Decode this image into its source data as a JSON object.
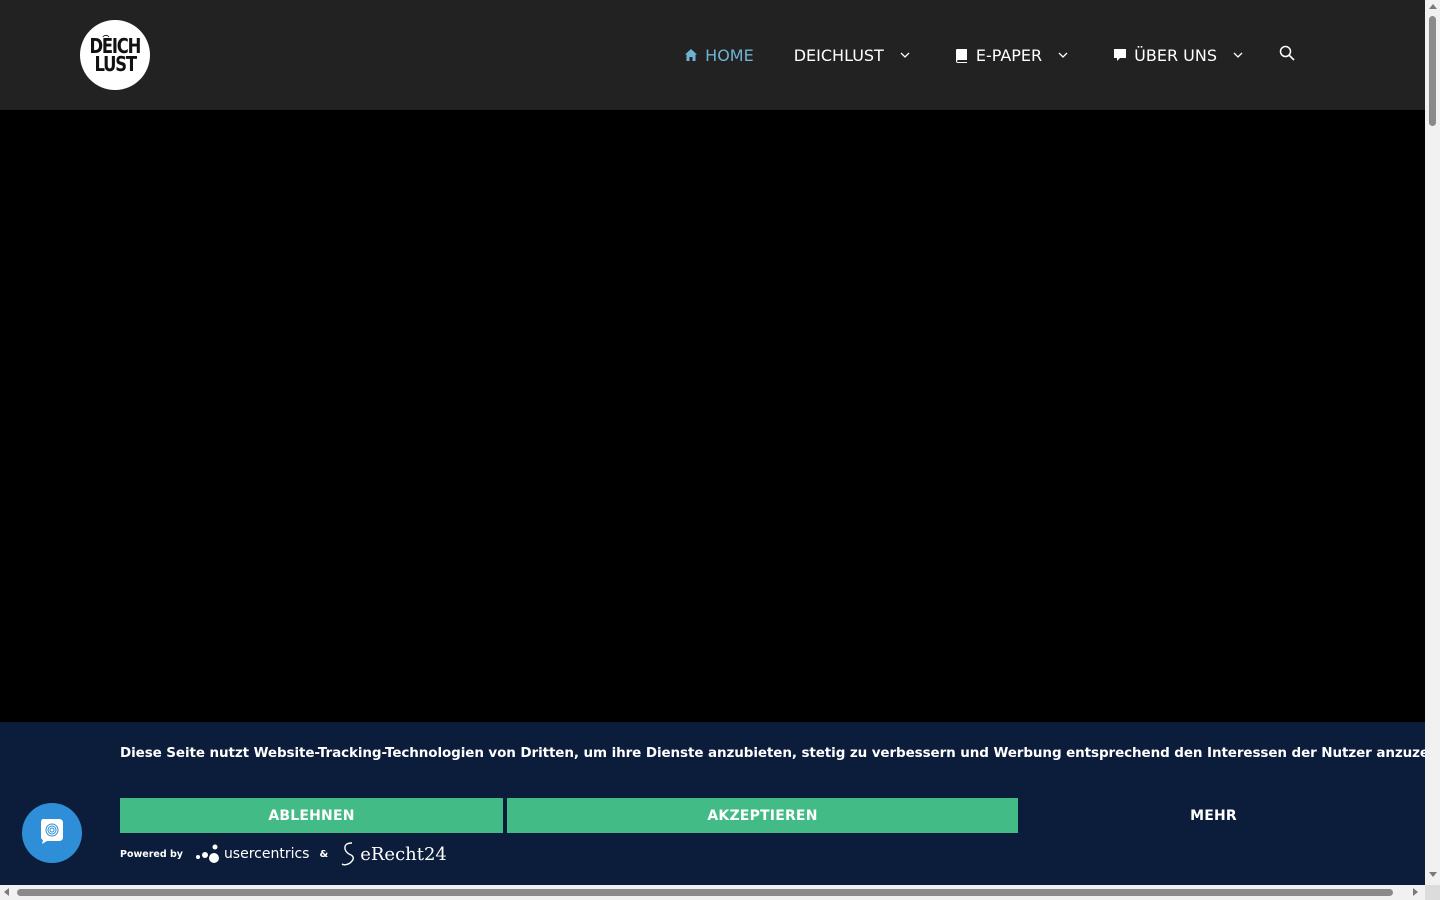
{
  "header": {
    "logo": {
      "line1": "DEICH",
      "line2": "LUST"
    },
    "nav": [
      {
        "label": "HOME",
        "icon": "home-icon",
        "active": true,
        "dropdown": false
      },
      {
        "label": "DEICHLUST",
        "icon": "",
        "active": false,
        "dropdown": true
      },
      {
        "label": "E-PAPER",
        "icon": "book-icon",
        "active": false,
        "dropdown": true
      },
      {
        "label": "ÜBER UNS",
        "icon": "speech-bubble-icon",
        "active": false,
        "dropdown": true
      }
    ],
    "search_icon": "search-icon"
  },
  "cookie_banner": {
    "text": "Diese Seite nutzt Website-Tracking-Technologien von Dritten, um ihre Dienste anzubieten, stetig zu verbessern und Werbung entsprechend den Interessen der Nutzer anzuzeigen.",
    "deny_label": "ABLEHNEN",
    "accept_label": "AKZEPTIEREN",
    "more_label": "MEHR",
    "powered_by": "Powered by",
    "usercentrics": "usercentrics",
    "ampersand": "&",
    "erecht": "eRecht24"
  },
  "colors": {
    "header_bg": "#222222",
    "nav_active": "#6fb3d2",
    "banner_bg": "#0b1d3a",
    "button_green": "#43bb86",
    "fab_blue": "#2e8fd8"
  }
}
